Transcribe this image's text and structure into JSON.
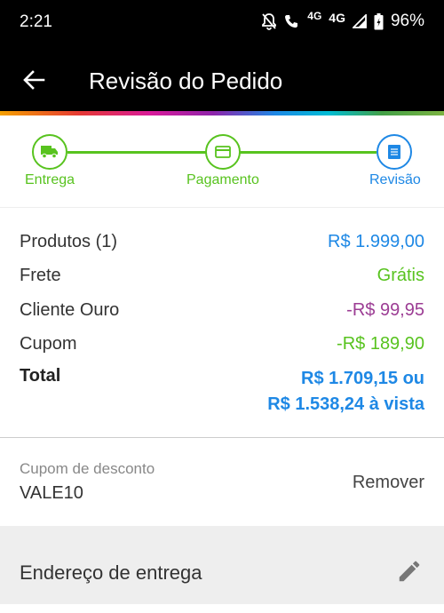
{
  "status": {
    "time": "2:21",
    "net1": "4G",
    "net2": "4G",
    "battery": "96%"
  },
  "header": {
    "title": "Revisão do Pedido"
  },
  "steps": [
    {
      "label": "Entrega",
      "icon": "truck-icon"
    },
    {
      "label": "Pagamento",
      "icon": "credit-card-icon"
    },
    {
      "label": "Revisão",
      "icon": "receipt-icon"
    }
  ],
  "colors": {
    "green": "#58c31f",
    "blue": "#1e88e5",
    "purple": "#9c3d94"
  },
  "summary": {
    "products_label": "Produtos (1)",
    "products_value": "R$ 1.999,00",
    "shipping_label": "Frete",
    "shipping_value": "Grátis",
    "gold_label": "Cliente Ouro",
    "gold_value": "-R$ 99,95",
    "coupon_label": "Cupom",
    "coupon_value": "-R$ 189,90",
    "total_label": "Total",
    "total_line1": "R$ 1.709,15 ou",
    "total_line2": "R$ 1.538,24 à vista"
  },
  "coupon": {
    "caption": "Cupom de desconto",
    "code": "VALE10",
    "remove_label": "Remover"
  },
  "address": {
    "title": "Endereço de entrega"
  }
}
